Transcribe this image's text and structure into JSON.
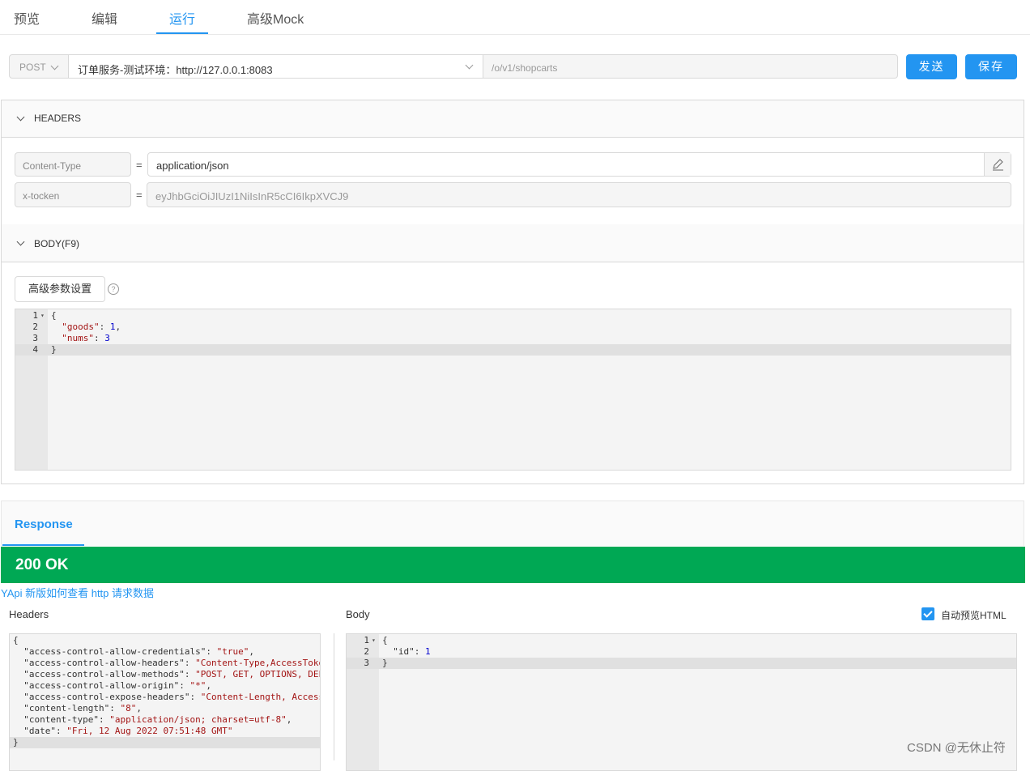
{
  "tabs": [
    {
      "label": "预览"
    },
    {
      "label": "编辑"
    },
    {
      "label": "运行"
    },
    {
      "label": "高级Mock"
    }
  ],
  "request": {
    "method": "POST",
    "env": "订单服务-测试环境：http://127.0.0.1:8083",
    "path": "/o/v1/shopcarts",
    "send_label": "发送",
    "save_label": "保存"
  },
  "headers_panel": {
    "title": "HEADERS",
    "rows": [
      {
        "key": "Content-Type",
        "eq": "=",
        "value": "application/json"
      },
      {
        "key": "x-tocken",
        "eq": "=",
        "value": "eyJhbGciOiJIUzI1NiIsInR5cCI6IkpXVCJ9"
      }
    ]
  },
  "body_panel": {
    "title": "BODY(F9)",
    "advanced_label": "高级参数设置",
    "help_icon": "?",
    "line_numbers": [
      "1",
      "2",
      "3",
      "4"
    ],
    "lines": [
      "{",
      "  \"goods\": 1,",
      "  \"nums\": 3",
      "}"
    ]
  },
  "response": {
    "tab_label": "Response",
    "status": "200 OK",
    "help_link": "YApi 新版如何查看 http 请求数据",
    "headers_label": "Headers",
    "body_label": "Body",
    "preview_html_label": "自动预览HTML",
    "preview_html_checked": true,
    "headers_lines": [
      "{",
      "  \"access-control-allow-credentials\": \"true\",",
      "  \"access-control-allow-headers\": \"Content-Type,AccessToke",
      "  \"access-control-allow-methods\": \"POST, GET, OPTIONS, DEL",
      "  \"access-control-allow-origin\": \"*\",",
      "  \"access-control-expose-headers\": \"Content-Length, Access",
      "  \"content-length\": \"8\",",
      "  \"content-type\": \"application/json; charset=utf-8\",",
      "  \"date\": \"Fri, 12 Aug 2022 07:51:48 GMT\"",
      "}"
    ],
    "body_line_numbers": [
      "1",
      "2",
      "3"
    ],
    "body_lines": [
      "{",
      "  \"id\": 1",
      "}"
    ]
  },
  "watermark": "CSDN @无休止符",
  "colors": {
    "accent": "#2395f1",
    "success": "#00a854"
  }
}
